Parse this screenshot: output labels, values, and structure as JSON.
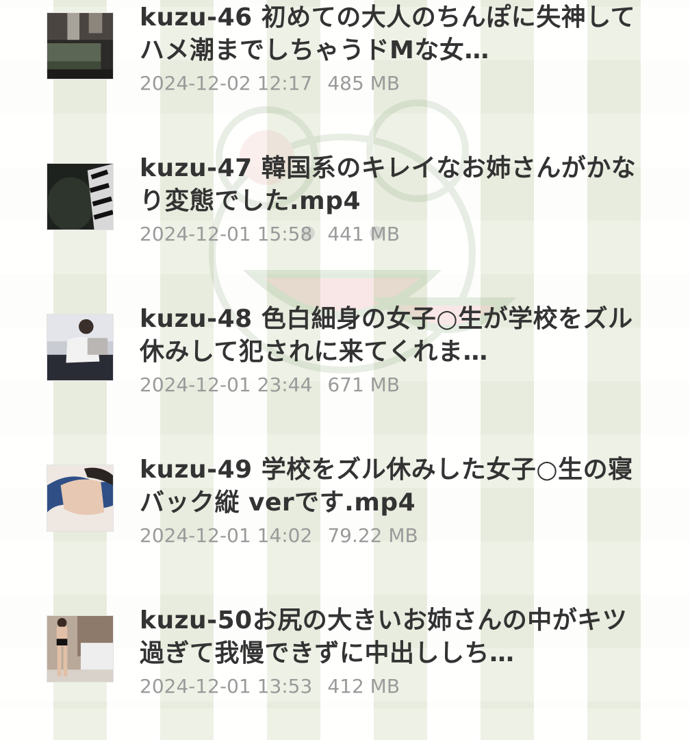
{
  "files": [
    {
      "name": "kuzu-46 初めての大人のちんぽに失神してハメ潮までしちゃうドMな女…",
      "date": "2024-12-02 12:17",
      "size": "485 MB",
      "thumb_icon": "sofa-room-thumbnail"
    },
    {
      "name": "kuzu-47 韓国系のキレイなお姉さんがかなり変態でした.mp4",
      "date": "2024-12-01 15:58",
      "size": "441 MB",
      "thumb_icon": "dark-room-thumbnail"
    },
    {
      "name": "kuzu-48 色白細身の女子○生が学校をズル休みして犯されに来てくれま…",
      "date": "2024-12-01 23:44",
      "size": "671 MB",
      "thumb_icon": "bedroom-thumbnail"
    },
    {
      "name": "kuzu-49 学校をズル休みした女子○生の寝バック縦 verです.mp4",
      "date": "2024-12-01 14:02",
      "size": "79.22 MB",
      "thumb_icon": "bed-thumbnail"
    },
    {
      "name": "kuzu-50お尻の大きいお姉さんの中がキツ過ぎて我慢できずに中出ししち…",
      "date": "2024-12-01 13:53",
      "size": "412 MB",
      "thumb_icon": "bathroom-thumbnail"
    }
  ]
}
